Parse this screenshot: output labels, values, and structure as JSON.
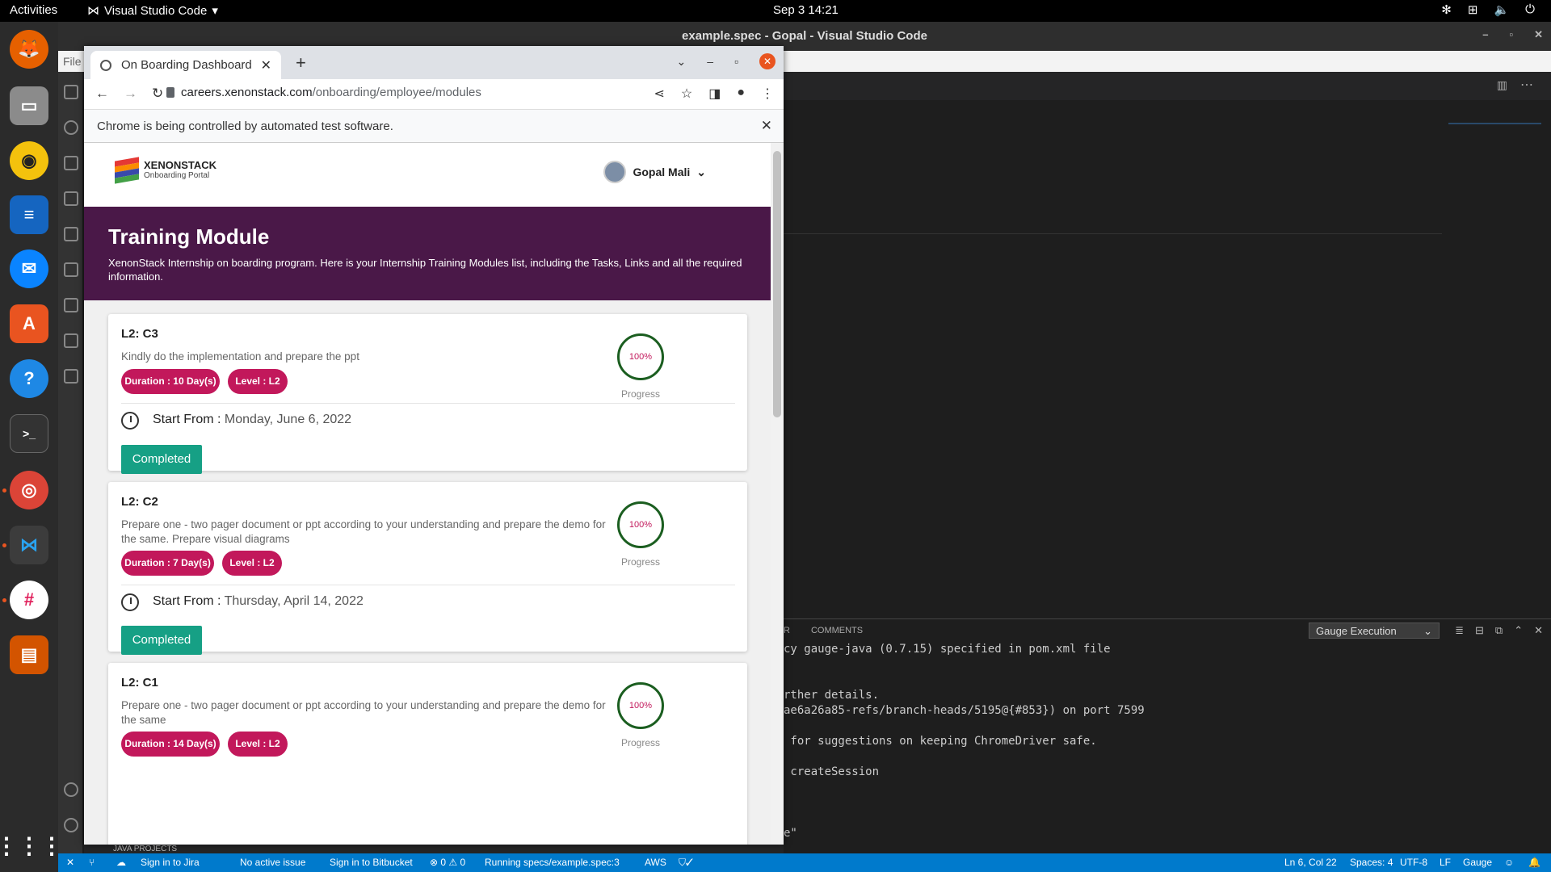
{
  "topbar": {
    "activities": "Activities",
    "app_name": "Visual Studio Code",
    "datetime": "Sep 3  14:21"
  },
  "dock": {
    "items": [
      "firefox-icon",
      "files-icon",
      "rhythmbox-icon",
      "writer-icon",
      "thunderbird-icon",
      "software-icon",
      "help-icon",
      "terminal-icon",
      "chrome-icon",
      "vscode-icon",
      "slack-icon",
      "impress-icon",
      "apps-grid-icon"
    ]
  },
  "vscode": {
    "title": "example.spec - Gopal - Visual Studio Code",
    "menu_file": "File",
    "panel": {
      "tab_partial": "R",
      "tab_comments": "COMMENTS",
      "select_value": "Gauge Execution",
      "lines": [
        "cy gauge-java (0.7.15) specified in pom.xml file",
        "",
        "",
        "rther details.",
        "ae6a26a85-refs/branch-heads/5195@{#853}) on port 7599",
        "",
        " for suggestions on keeping ChromeDriver safe.",
        "",
        " createSession",
        "",
        "",
        "",
        "e\""
      ]
    },
    "java_projects": "JAVA PROJECTS",
    "status": {
      "jira": "Sign in to Jira",
      "issue": "No active issue",
      "bitbucket": "Sign in to Bitbucket",
      "problems": "⊗ 0 ⚠ 0",
      "running": "Running specs/example.spec:3",
      "aws": "AWS",
      "position": "Ln 6, Col 22",
      "spaces": "Spaces: 4",
      "encoding": "UTF-8",
      "eol": "LF",
      "lang": "Gauge"
    }
  },
  "browser": {
    "tab_title": "On Boarding Dashboard",
    "url_host": "careers.xenonstack.com",
    "url_path": "/onboarding/employee/modules",
    "infobar": "Chrome is being controlled by automated test software."
  },
  "site": {
    "brand": "XENONSTACK",
    "brand_sub": "Onboarding Portal",
    "user": "Gopal Mali",
    "hero_title": "Training Module",
    "hero_text": "XenonStack Internship on boarding program. Here is your Internship Training Modules list, including the Tasks, Links and all the required information.",
    "start_label": "Start From :",
    "progress_label": "Progress",
    "modules": [
      {
        "title": "L2: C3",
        "desc": "Kindly do the implementation and prepare the ppt",
        "duration": "Duration : 10 Day(s)",
        "level": "Level : L2",
        "progress": "100%",
        "start": "Monday, June 6, 2022",
        "status": "Completed"
      },
      {
        "title": "L2: C2",
        "desc": "Prepare one - two pager document or ppt according to your understanding and prepare the demo for the same. Prepare visual diagrams",
        "duration": "Duration : 7 Day(s)",
        "level": "Level : L2",
        "progress": "100%",
        "start": "Thursday, April 14, 2022",
        "status": "Completed"
      },
      {
        "title": "L2: C1",
        "desc": "Prepare one - two pager document or ppt according to your understanding and prepare the demo for the same",
        "duration": "Duration : 14 Day(s)",
        "level": "Level : L2",
        "progress": "100%"
      }
    ]
  }
}
